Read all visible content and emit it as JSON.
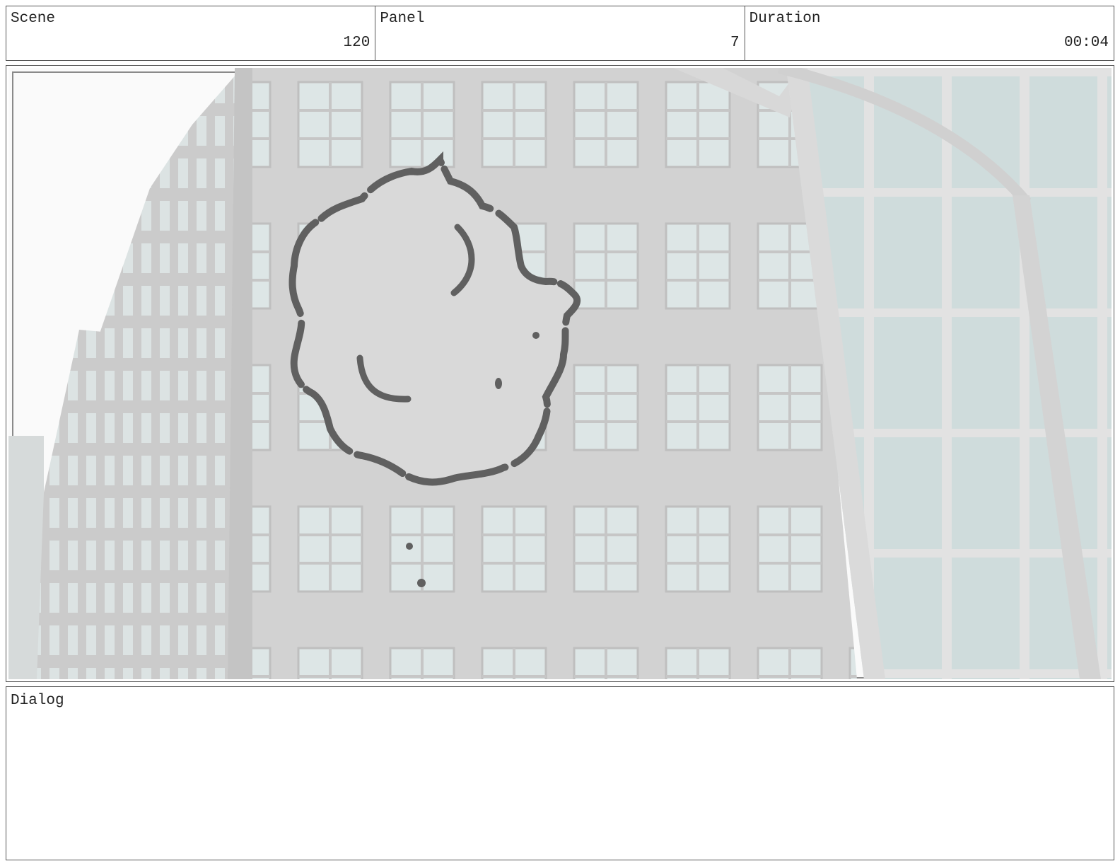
{
  "header": {
    "scene": {
      "label": "Scene",
      "value": "120"
    },
    "panel": {
      "label": "Panel",
      "value": "7"
    },
    "duration": {
      "label": "Duration",
      "value": "00:04"
    }
  },
  "artwork": {
    "description_icons": [
      "building-facade",
      "glass-tower",
      "street-lamp",
      "smoke-cloud-sketch"
    ],
    "colors": {
      "facade": "#d4d4d4",
      "window": "#dbe4e4",
      "glass": "#c8d8d8",
      "sketch": "#606060"
    }
  },
  "dialog": {
    "label": "Dialog",
    "text": ""
  }
}
